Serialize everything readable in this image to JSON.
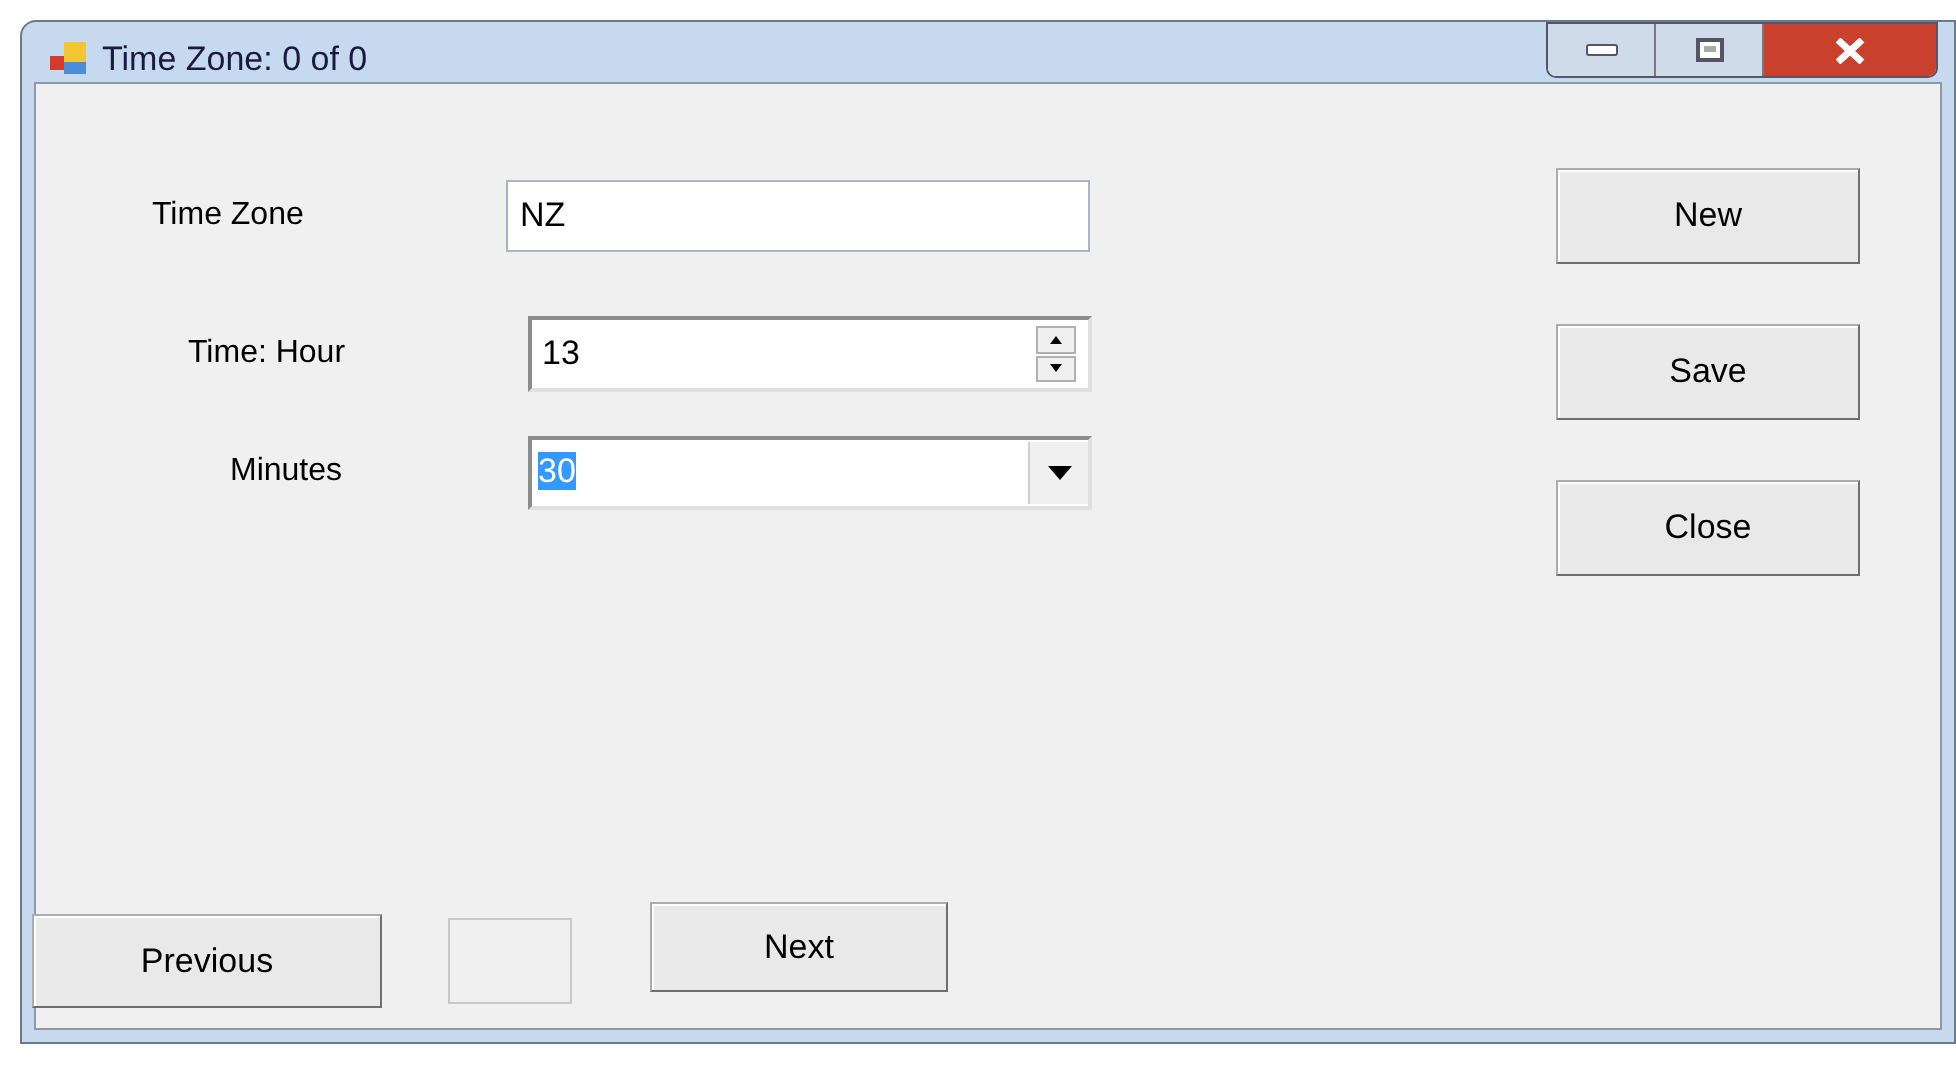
{
  "window": {
    "title": "Time Zone: 0 of 0"
  },
  "fields": [
    {
      "kind": "text",
      "label": "Time Zone",
      "value": "NZ"
    },
    {
      "kind": "spinner",
      "label": "Time: Hour",
      "value": "13"
    },
    {
      "kind": "dropdown",
      "label": "Minutes",
      "value": "30",
      "value_selected": true
    }
  ],
  "side_buttons": [
    "New",
    "Save",
    "Close"
  ],
  "nav": {
    "previous": "Previous",
    "next": "Next"
  }
}
